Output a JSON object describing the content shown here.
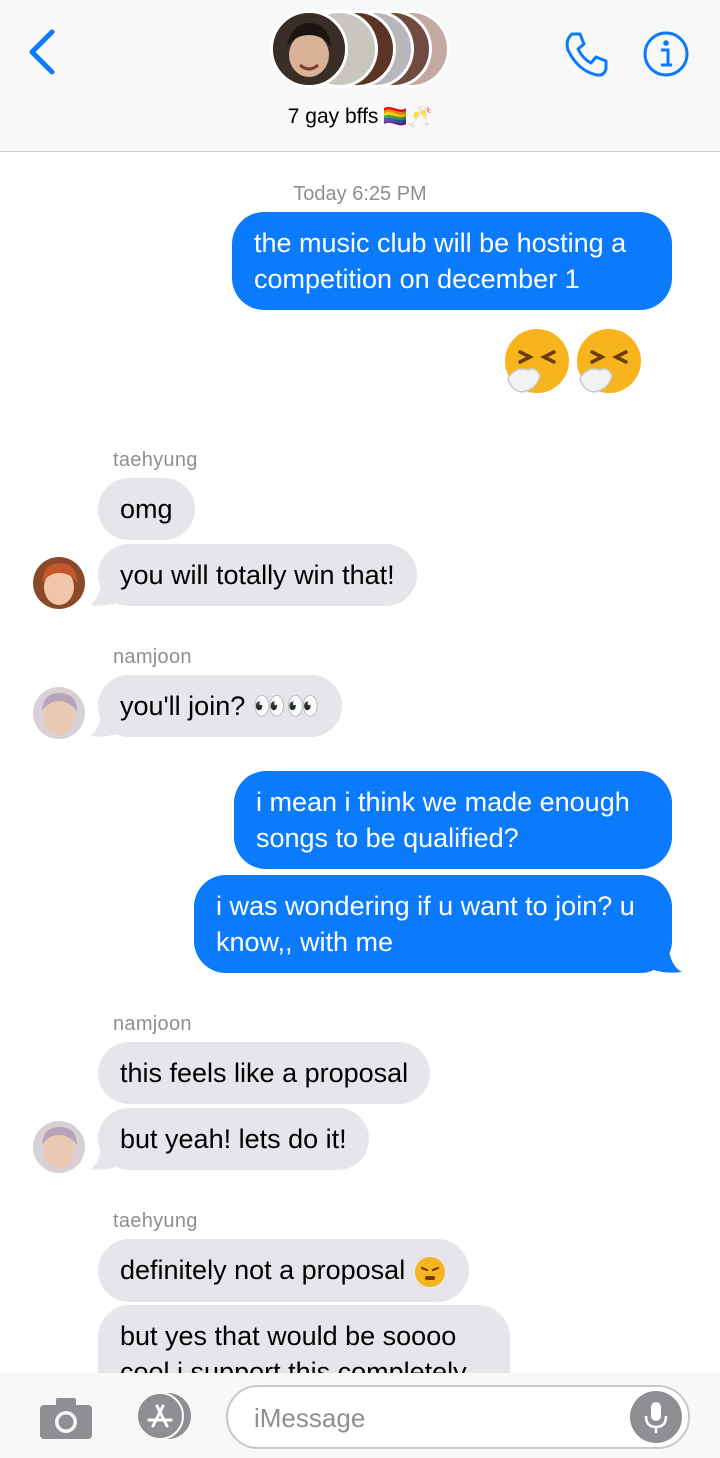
{
  "header": {
    "back_icon": "chevron-left-icon",
    "group_name": "7 gay bffs",
    "group_emoji": "🏳️‍🌈🥂",
    "phone_icon": "phone-icon",
    "info_icon": "info-icon"
  },
  "chat": {
    "timestamp_day": "Today",
    "timestamp_time": "6:25 PM",
    "messages": [
      {
        "from": "me",
        "text": "the music club will be hosting a competition on december 1"
      },
      {
        "from": "me",
        "text": "😷😷"
      },
      {
        "sender": "taehyung",
        "text": "omg"
      },
      {
        "sender": "taehyung",
        "text": "you will totally win that!"
      },
      {
        "sender": "namjoon",
        "text": "you'll join? 👀👀"
      },
      {
        "from": "me",
        "text": "i mean i think we made enough songs to be qualified?"
      },
      {
        "from": "me",
        "text": "i was wondering if u want to join? u know,, with me"
      },
      {
        "sender": "namjoon",
        "text": "this feels like a proposal"
      },
      {
        "sender": "namjoon",
        "text": "but yeah! lets do it!"
      },
      {
        "sender": "taehyung",
        "text": "definitely not a proposal"
      },
      {
        "sender": "taehyung",
        "text": "but yes that would be soooo cool i support this completely"
      }
    ]
  },
  "input": {
    "placeholder": "iMessage",
    "camera_icon": "camera-icon",
    "apps_icon": "app-store-icon",
    "mic_icon": "microphone-icon"
  },
  "colors": {
    "accent": "#0b7bfc",
    "incoming_bubble": "#e5e5ea",
    "meta_text": "#8e8e93"
  }
}
